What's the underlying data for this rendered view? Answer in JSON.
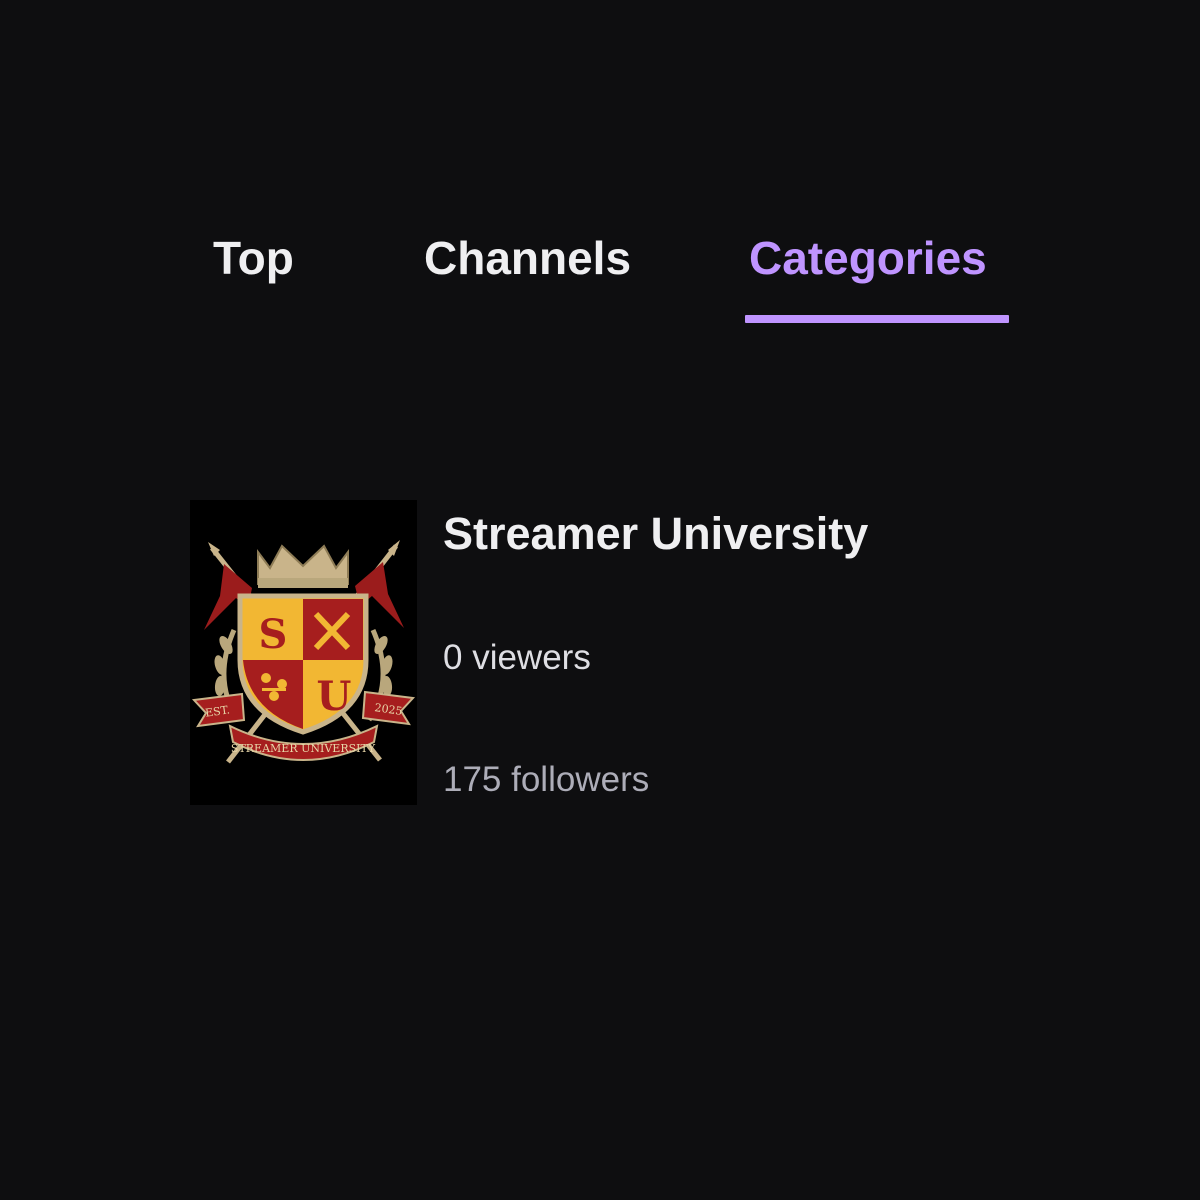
{
  "tabs": [
    {
      "label": "Top",
      "active": false
    },
    {
      "label": "Channels",
      "active": false
    },
    {
      "label": "Categories",
      "active": true
    }
  ],
  "colors": {
    "background": "#0e0e10",
    "accent": "#bf94ff",
    "text_primary": "#efeff1",
    "text_secondary": "#adadb8"
  },
  "result": {
    "title": "Streamer University",
    "viewers": "0 viewers",
    "followers": "175 followers",
    "crest": {
      "icon": "university-crest-icon",
      "shield_letters": [
        "S",
        "U"
      ],
      "banner_left": "EST.",
      "banner_right": "2025",
      "ribbon": "STREAMER UNIVERSITY"
    }
  }
}
